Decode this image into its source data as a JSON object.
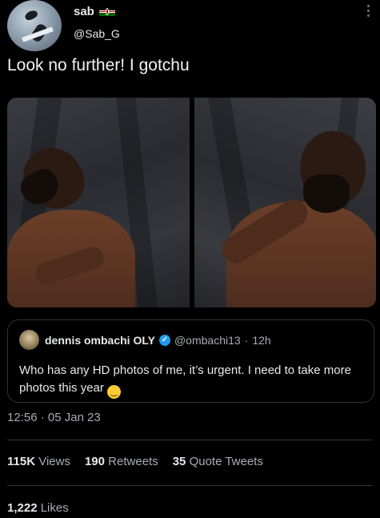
{
  "author": {
    "display_name": "sab",
    "flag_icon": "kenya-flag-icon",
    "handle": "@Sab_G"
  },
  "tweet": {
    "text": "Look no further! I gotchu"
  },
  "media": {
    "images": [
      {
        "icon": "photo-man-head-tilted"
      },
      {
        "icon": "photo-man-finger-on-lip"
      }
    ]
  },
  "quoted_tweet": {
    "author_name": "dennis ombachi OLY",
    "verified_icon": "verified-badge-icon",
    "handle": "@ombachi13",
    "separator": "·",
    "time": "12h",
    "text": "Who has any HD photos of me, it’s urgent. I need to take more photos this year",
    "emoji": "😂"
  },
  "meta": {
    "time": "12:56",
    "separator": "·",
    "date": "05 Jan 23"
  },
  "stats": {
    "views_count": "115K",
    "views_label": "Views",
    "retweets_count": "190",
    "retweets_label": "Retweets",
    "quotes_count": "35",
    "quotes_label": "Quote Tweets",
    "likes_count": "1,222",
    "likes_label": "Likes"
  },
  "colors": {
    "background": "#000000",
    "text_primary": "#e7e9ea",
    "text_secondary": "#a8adb2",
    "border": "#2f3336",
    "verified": "#1d9bf0"
  }
}
